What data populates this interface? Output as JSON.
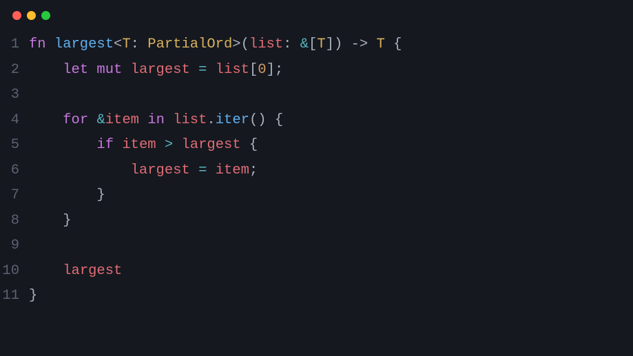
{
  "window": {
    "buttons": [
      "close",
      "minimize",
      "zoom"
    ]
  },
  "code": {
    "language": "rust",
    "lines": [
      {
        "n": 1,
        "tokens": [
          {
            "c": "k-keyword",
            "t": "fn "
          },
          {
            "c": "k-fn",
            "t": "largest"
          },
          {
            "c": "k-punct",
            "t": "<"
          },
          {
            "c": "k-type",
            "t": "T"
          },
          {
            "c": "k-punct",
            "t": ": "
          },
          {
            "c": "k-type",
            "t": "PartialOrd"
          },
          {
            "c": "k-punct",
            "t": ">("
          },
          {
            "c": "k-var",
            "t": "list"
          },
          {
            "c": "k-punct",
            "t": ": "
          },
          {
            "c": "k-op",
            "t": "&"
          },
          {
            "c": "k-punct",
            "t": "["
          },
          {
            "c": "k-type",
            "t": "T"
          },
          {
            "c": "k-punct",
            "t": "]) "
          },
          {
            "c": "k-punct",
            "t": "-> "
          },
          {
            "c": "k-type",
            "t": "T"
          },
          {
            "c": "k-punct",
            "t": " {"
          }
        ]
      },
      {
        "n": 2,
        "tokens": [
          {
            "c": "k-text",
            "t": "    "
          },
          {
            "c": "k-keyword",
            "t": "let mut"
          },
          {
            "c": "k-text",
            "t": " "
          },
          {
            "c": "k-var",
            "t": "largest"
          },
          {
            "c": "k-text",
            "t": " "
          },
          {
            "c": "k-op",
            "t": "="
          },
          {
            "c": "k-text",
            "t": " "
          },
          {
            "c": "k-var",
            "t": "list"
          },
          {
            "c": "k-punct",
            "t": "["
          },
          {
            "c": "k-num",
            "t": "0"
          },
          {
            "c": "k-punct",
            "t": "];"
          }
        ]
      },
      {
        "n": 3,
        "tokens": []
      },
      {
        "n": 4,
        "tokens": [
          {
            "c": "k-text",
            "t": "    "
          },
          {
            "c": "k-keyword",
            "t": "for"
          },
          {
            "c": "k-text",
            "t": " "
          },
          {
            "c": "k-op",
            "t": "&"
          },
          {
            "c": "k-var",
            "t": "item"
          },
          {
            "c": "k-text",
            "t": " "
          },
          {
            "c": "k-keyword",
            "t": "in"
          },
          {
            "c": "k-text",
            "t": " "
          },
          {
            "c": "k-var",
            "t": "list"
          },
          {
            "c": "k-punct",
            "t": "."
          },
          {
            "c": "k-fn",
            "t": "iter"
          },
          {
            "c": "k-punct",
            "t": "() {"
          }
        ]
      },
      {
        "n": 5,
        "tokens": [
          {
            "c": "k-text",
            "t": "        "
          },
          {
            "c": "k-keyword",
            "t": "if"
          },
          {
            "c": "k-text",
            "t": " "
          },
          {
            "c": "k-var",
            "t": "item"
          },
          {
            "c": "k-text",
            "t": " "
          },
          {
            "c": "k-op",
            "t": ">"
          },
          {
            "c": "k-text",
            "t": " "
          },
          {
            "c": "k-var",
            "t": "largest"
          },
          {
            "c": "k-punct",
            "t": " {"
          }
        ]
      },
      {
        "n": 6,
        "tokens": [
          {
            "c": "k-text",
            "t": "            "
          },
          {
            "c": "k-var",
            "t": "largest"
          },
          {
            "c": "k-text",
            "t": " "
          },
          {
            "c": "k-op",
            "t": "="
          },
          {
            "c": "k-text",
            "t": " "
          },
          {
            "c": "k-var",
            "t": "item"
          },
          {
            "c": "k-punct",
            "t": ";"
          }
        ]
      },
      {
        "n": 7,
        "tokens": [
          {
            "c": "k-text",
            "t": "        "
          },
          {
            "c": "k-punct",
            "t": "}"
          }
        ]
      },
      {
        "n": 8,
        "tokens": [
          {
            "c": "k-text",
            "t": "    "
          },
          {
            "c": "k-punct",
            "t": "}"
          }
        ]
      },
      {
        "n": 9,
        "tokens": []
      },
      {
        "n": 10,
        "tokens": [
          {
            "c": "k-text",
            "t": "    "
          },
          {
            "c": "k-var",
            "t": "largest"
          }
        ]
      },
      {
        "n": 11,
        "tokens": [
          {
            "c": "k-punct",
            "t": "}"
          }
        ]
      }
    ]
  }
}
